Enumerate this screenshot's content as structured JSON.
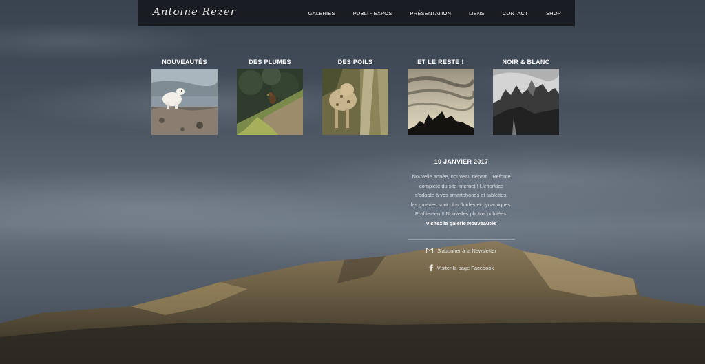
{
  "site": {
    "logo": "Antoine Rezer"
  },
  "nav": [
    "GALERIES",
    "PUBLI - EXPOS",
    "PRÉSENTATION",
    "LIENS",
    "CONTACT",
    "SHOP"
  ],
  "galleries": [
    {
      "title": "NOUVEAUTÉS",
      "icon": "polar-bear-photo"
    },
    {
      "title": "DES PLUMES",
      "icon": "bird-photo"
    },
    {
      "title": "DES POILS",
      "icon": "lynx-photo"
    },
    {
      "title": "ET LE RESTE !",
      "icon": "mountain-silhouette-photo"
    },
    {
      "title": "NOIR & BLANC",
      "icon": "bw-mountain-photo"
    }
  ],
  "news": {
    "date": "10 JANVIER 2017",
    "lines": [
      "Nouvelle année, nouveau départ... Refonte",
      "complète du site internet ! L'interface",
      "s'adapte à vos smartphones et tablettes,",
      "les galeries sont plus fluides et dynamiques.",
      "Profitez-en !! Nouvelles photos publiées."
    ],
    "link": "Visitez la galerie Nouveautés"
  },
  "social": {
    "newsletter": {
      "label": "S'abonner à la Newsletter",
      "icon": "envelope-icon"
    },
    "facebook": {
      "label": "Visiter la page Facebook",
      "icon": "facebook-icon"
    }
  }
}
